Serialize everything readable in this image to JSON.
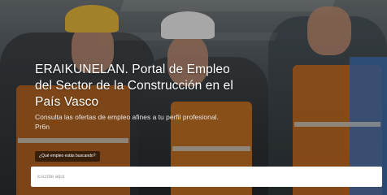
{
  "hero": {
    "title": "ERAIKUNELAN. Portal de Empleo del Sector de la Construcción en el País Vasco",
    "subtitle": "Consulta las ofertas de empleo afines a tu perfil profesional. Pr6n",
    "search_label": "¿Qué empleo estás buscando?",
    "search_placeholder": "Escribe aquí"
  }
}
